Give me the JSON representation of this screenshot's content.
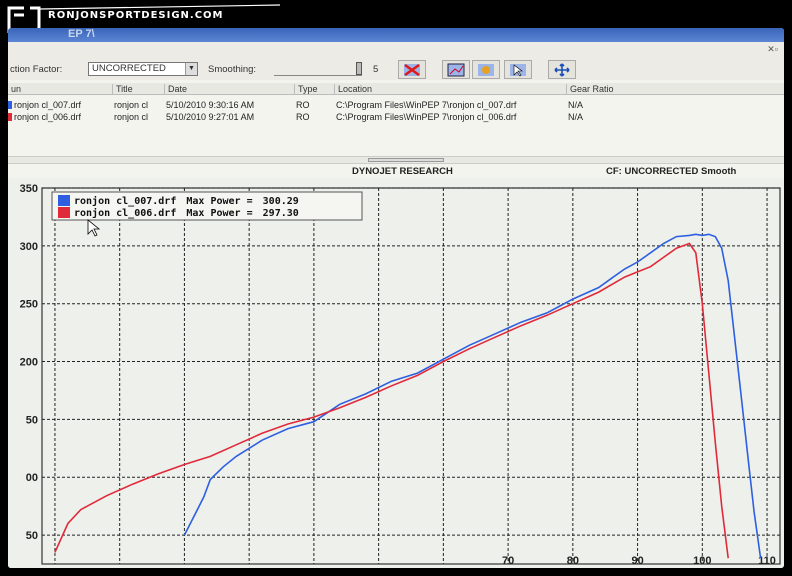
{
  "brand": {
    "text": "RONJONSPORTDESIGN.COM"
  },
  "window": {
    "title": "EP 7\\"
  },
  "toolbar": {
    "correction_label": "ction Factor:",
    "correction_value": "UNCORRECTED",
    "smoothing_label": "Smoothing:",
    "smoothing_value": "5",
    "buttons": [
      "delete-run-icon",
      "zoom-icon",
      "pan-hand-icon",
      "cursor-icon",
      "move-arrows-icon"
    ]
  },
  "runs_table": {
    "headers": [
      "un",
      "Title",
      "Date",
      "Type",
      "Location",
      "Gear Ratio"
    ],
    "rows": [
      {
        "color": "#2d5fe0",
        "file": "ronjon cl_007.drf",
        "title": "ronjon cl",
        "date": "5/10/2010 9:30:16 AM",
        "type": "RO",
        "location": "C:\\Program Files\\WinPEP 7\\ronjon cl_007.drf",
        "gear": "N/A"
      },
      {
        "color": "#e02a3a",
        "file": "ronjon cl_006.drf",
        "title": "ronjon cl",
        "date": "5/10/2010 9:27:01 AM",
        "type": "RO",
        "location": "C:\\Program Files\\WinPEP 7\\ronjon cl_006.drf",
        "gear": "N/A"
      }
    ]
  },
  "graph_header": {
    "title": "DYNOJET RESEARCH",
    "cf": "CF: UNCORRECTED  Smooth"
  },
  "chart_data": {
    "type": "line",
    "ylim": [
      25,
      350
    ],
    "xlim": [
      -2,
      112
    ],
    "y_ticks": [
      350,
      300,
      250,
      200,
      150,
      100,
      50
    ],
    "y_tick_labels": [
      "350",
      "300",
      "250",
      "200",
      "50",
      "00",
      "50"
    ],
    "x_ticks": [
      70,
      80,
      90,
      100,
      110
    ],
    "x_tick_labels": [
      "70",
      "80",
      "90",
      "100",
      "110"
    ],
    "grid": true,
    "legend_position": "top-left",
    "legend": [
      {
        "file": "ronjon cl_007.drf",
        "label": "Max Power =",
        "value": "300.29",
        "color": "#2d5fe0"
      },
      {
        "file": "ronjon cl_006.drf",
        "label": "Max Power =",
        "value": "297.30",
        "color": "#e02a3a"
      }
    ],
    "series": [
      {
        "color": "#2d5fe0",
        "x": [
          20,
          22,
          23,
          24,
          26,
          28,
          32,
          36,
          40,
          44,
          48,
          52,
          56,
          60,
          64,
          68,
          72,
          76,
          78,
          80,
          84,
          86,
          88,
          90,
          92,
          94,
          96,
          98,
          99,
          100,
          101,
          102,
          103,
          104,
          105,
          106,
          107,
          108,
          109
        ],
        "y": [
          50,
          72,
          83,
          98,
          109,
          118,
          132,
          142,
          148,
          163,
          172,
          183,
          190,
          202,
          214,
          224,
          234,
          242,
          248,
          254,
          264,
          272,
          280,
          286,
          294,
          302,
          308,
          309,
          310,
          309,
          310,
          308,
          298,
          270,
          220,
          170,
          120,
          70,
          30
        ]
      },
      {
        "color": "#e02a3a",
        "x": [
          0,
          2,
          4,
          8,
          12,
          16,
          20,
          24,
          28,
          32,
          36,
          40,
          44,
          48,
          52,
          56,
          60,
          64,
          68,
          72,
          76,
          80,
          84,
          88,
          92,
          94,
          96,
          98,
          99,
          100,
          101,
          102,
          103,
          104
        ],
        "y": [
          35,
          60,
          72,
          84,
          94,
          103,
          111,
          118,
          128,
          138,
          146,
          152,
          160,
          169,
          179,
          188,
          200,
          211,
          221,
          231,
          240,
          250,
          260,
          273,
          282,
          290,
          298,
          302,
          294,
          250,
          190,
          130,
          75,
          30
        ]
      }
    ]
  }
}
